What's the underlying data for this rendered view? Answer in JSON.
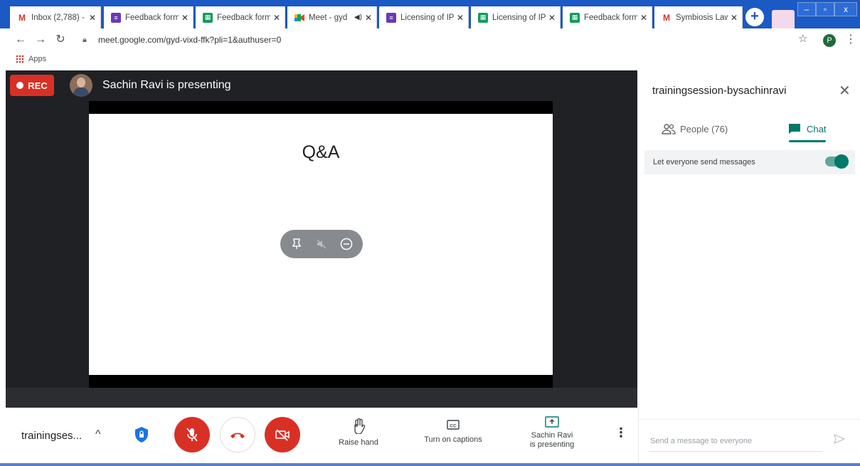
{
  "browser": {
    "tabs": [
      {
        "title": "Inbox (2,788) -",
        "icon": "gmail-icon"
      },
      {
        "title": "Feedback form",
        "icon": "forms-icon"
      },
      {
        "title": "Feedback form",
        "icon": "sheets-icon"
      },
      {
        "title": "Meet - gyd",
        "icon": "meet-icon",
        "active": true
      },
      {
        "title": "Licensing of IP",
        "icon": "forms-icon"
      },
      {
        "title": "Licensing of IP",
        "icon": "sheets-icon"
      },
      {
        "title": "Feedback form",
        "icon": "sheets-icon"
      },
      {
        "title": "Symbiosis Law",
        "icon": "gmail-icon"
      }
    ],
    "close_glyph": "✕",
    "new_tab_glyph": "+",
    "window_controls": {
      "minimize": "–",
      "maximize": "▫",
      "close": "x"
    },
    "url": "meet.google.com/gyd-vixd-ffk?pli=1&authuser=0",
    "profile_initial": "P",
    "bookmarks": {
      "apps_label": "Apps"
    }
  },
  "meet": {
    "rec_label": "REC",
    "presenting_title": "Sachin Ravi is presenting",
    "slide_title": "Q&A",
    "meeting_name": "trainingses...",
    "raise_hand_label": "Raise hand",
    "captions_label": "Turn on captions",
    "present_label_line1": "Sachin Ravi",
    "present_label_line2": "is presenting"
  },
  "panel": {
    "title": "trainingsession-bysachinravi",
    "tab_people": "People (76)",
    "tab_chat": "Chat",
    "setting_label": "Let everyone send messages",
    "message_placeholder": "Send a message to everyone"
  },
  "colors": {
    "tabstrip": "#1b59c4",
    "meet_red": "#d93025",
    "meet_teal": "#00796b",
    "stage_bg": "#202124"
  }
}
